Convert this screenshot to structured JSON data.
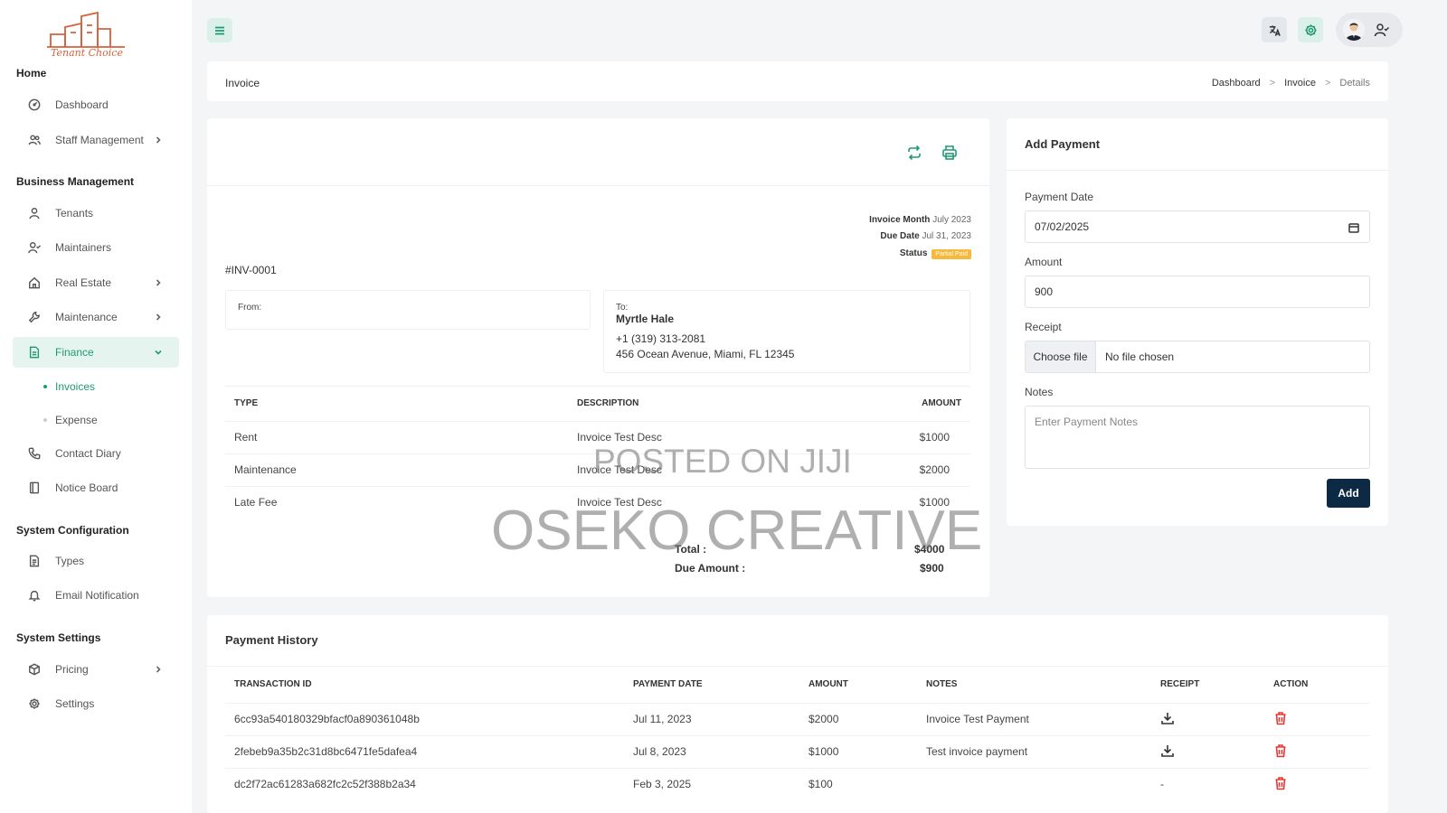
{
  "app": {
    "logo_text": "Tenant Choice"
  },
  "sidebar": {
    "sections": {
      "home": "Home",
      "business": "Business Management",
      "system_config": "System Configuration",
      "system_settings": "System Settings"
    },
    "items": {
      "dashboard": "Dashboard",
      "staff": "Staff Management",
      "tenants": "Tenants",
      "maintainers": "Maintainers",
      "real_estate": "Real Estate",
      "maintenance": "Maintenance",
      "finance": "Finance",
      "invoices": "Invoices",
      "expense": "Expense",
      "contact_diary": "Contact Diary",
      "notice_board": "Notice Board",
      "types": "Types",
      "email_notification": "Email Notification",
      "pricing": "Pricing",
      "settings": "Settings"
    }
  },
  "header": {
    "page_title": "Invoice",
    "breadcrumb": [
      "Dashboard",
      "Invoice",
      "Details"
    ]
  },
  "invoice": {
    "number": "#INV-0001",
    "invoice_month_label": "Invoice Month",
    "invoice_month": "July 2023",
    "due_date_label": "Due Date",
    "due_date": "Jul 31, 2023",
    "status_label": "Status",
    "status": "Partial Paid",
    "from_label": "From:",
    "to_label": "To:",
    "to_name": "Myrtle Hale",
    "to_phone": "+1 (319) 313-2081",
    "to_address": "456 Ocean Avenue, Miami, FL 12345",
    "columns": {
      "type": "TYPE",
      "description": "DESCRIPTION",
      "amount": "AMOUNT"
    },
    "rows": [
      {
        "type": "Rent",
        "description": "Invoice Test Desc",
        "amount": "$1000"
      },
      {
        "type": "Maintenance",
        "description": "Invoice Test Desc",
        "amount": "$2000"
      },
      {
        "type": "Late Fee",
        "description": "Invoice Test Desc",
        "amount": "$1000"
      }
    ],
    "total_label": "Total :",
    "total": "$4000",
    "due_amount_label": "Due Amount :",
    "due_amount": "$900"
  },
  "payment_form": {
    "title": "Add Payment",
    "date_label": "Payment Date",
    "date_value": "07/02/2025",
    "amount_label": "Amount",
    "amount_value": "900",
    "receipt_label": "Receipt",
    "choose_file": "Choose file",
    "no_file": "No file chosen",
    "notes_label": "Notes",
    "notes_placeholder": "Enter Payment Notes",
    "submit": "Add"
  },
  "payment_history": {
    "title": "Payment History",
    "columns": {
      "id": "TRANSACTION ID",
      "date": "PAYMENT DATE",
      "amount": "AMOUNT",
      "notes": "NOTES",
      "receipt": "RECEIPT",
      "action": "ACTION"
    },
    "rows": [
      {
        "id": "6cc93a540180329bfacf0a890361048b",
        "date": "Jul 11, 2023",
        "amount": "$2000",
        "notes": "Invoice Test Payment",
        "receipt": ""
      },
      {
        "id": "2febeb9a35b2c31d8bc6471fe5dafea4",
        "date": "Jul 8, 2023",
        "amount": "$1000",
        "notes": "Test invoice payment",
        "receipt": ""
      },
      {
        "id": "dc2f72ac61283a682fc2c52f388b2a34",
        "date": "Feb 3, 2025",
        "amount": "$100",
        "notes": "",
        "receipt": "-"
      }
    ]
  },
  "watermarks": {
    "line1": "POSTED ON JIJI",
    "line2": "OSEKO CREATIVE"
  },
  "colors": {
    "accent": "#1f9a72",
    "navy": "#0d2a45",
    "danger": "#e53935",
    "badge": "#f6b93b"
  }
}
